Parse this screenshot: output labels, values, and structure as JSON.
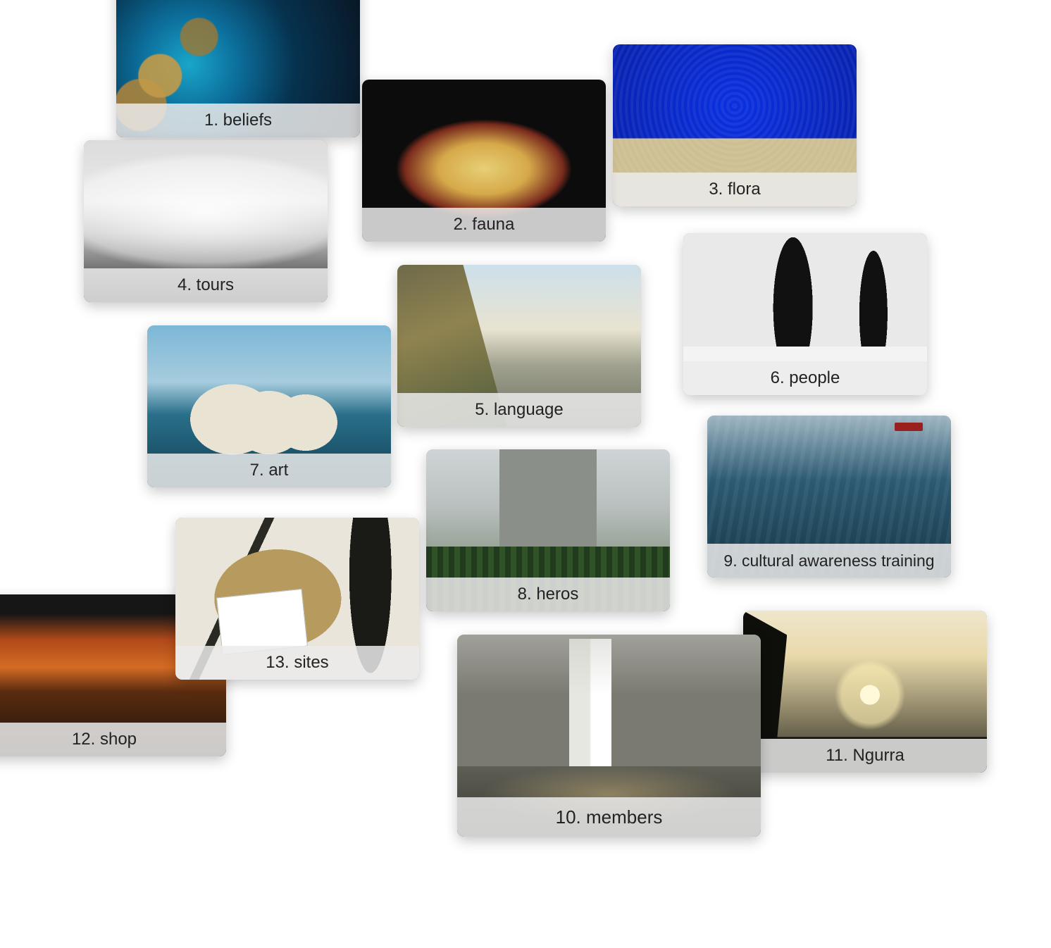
{
  "cards": {
    "beliefs": {
      "label": "1. beliefs"
    },
    "fauna": {
      "label": "2. fauna"
    },
    "flora": {
      "label": "3. flora"
    },
    "tours": {
      "label": "4. tours"
    },
    "language": {
      "label": "5. language"
    },
    "people": {
      "label": "6. people"
    },
    "art": {
      "label": "7. art"
    },
    "heros": {
      "label": "8. heros"
    },
    "cat": {
      "label": "9. cultural awareness training"
    },
    "members": {
      "label": "10. members"
    },
    "ngurra": {
      "label": "11. Ngurra"
    },
    "shop": {
      "label": "12. shop"
    },
    "sites": {
      "label": "13. sites"
    }
  }
}
